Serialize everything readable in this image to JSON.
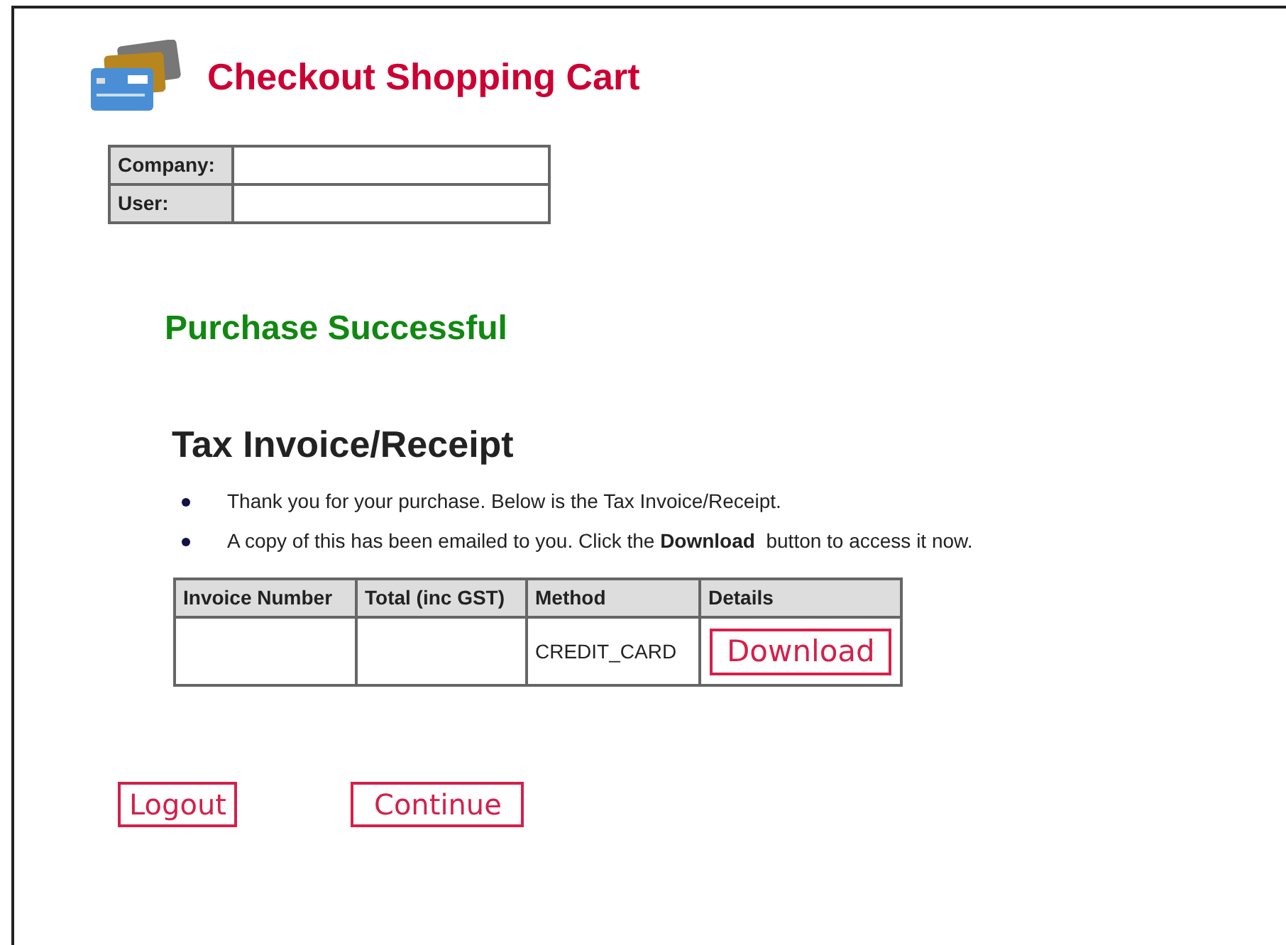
{
  "header": {
    "title": "Checkout Shopping Cart"
  },
  "account": [
    {
      "label": "Company:"
    },
    {
      "label": "User:"
    }
  ],
  "status": "Purchase Successful",
  "invoice": {
    "heading": "Tax Invoice/Receipt",
    "notes": [
      "Thank you for your purchase. Below is the Tax Invoice/Receipt.",
      "A copy of this has been emailed to you. Click the **Download**  button to access it now."
    ],
    "columns": [
      "Invoice Number",
      "Total (inc GST)",
      "Method",
      "Details"
    ],
    "rows": [
      {
        "method": "CREDIT_CARD",
        "action": "Download"
      }
    ]
  },
  "buttons": [
    "Logout",
    "Continue"
  ]
}
